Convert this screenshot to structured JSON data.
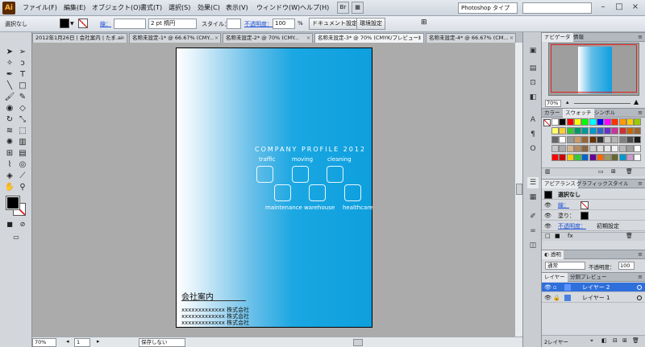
{
  "app": {
    "logo": "Ai"
  },
  "menu": [
    "ファイル(F)",
    "編集(E)",
    "オブジェクト(O)",
    "書式(T)",
    "選択(S)",
    "効果(C)",
    "表示(V)",
    "ウィンドウ(W)",
    "ヘルプ(H)"
  ],
  "workspace": "Photoshop タイプ",
  "window_controls": [
    "–",
    "□",
    "×"
  ],
  "control_bar": {
    "selection": "選択なし",
    "stroke_label": "線：",
    "stroke_weight": "2 pt 楕円",
    "style_label": "スタイル：",
    "opacity_label": "不透明度：",
    "opacity_value": "100",
    "opacity_unit": "%",
    "doc_setup": "ドキュメント設定",
    "env_setup": "環境設定"
  },
  "tabs": [
    {
      "label": "2012年1月26日 | 会社案内 | たま.ai",
      "active": false
    },
    {
      "label": "名称未設定-1* @ 66.67% (CMY...",
      "active": false
    },
    {
      "label": "名称未設定-2* @ 70% (CMY...",
      "active": false
    },
    {
      "label": "名称未設定-3* @ 70% (CMYK/プレビュー)",
      "active": true
    },
    {
      "label": "名称未設定-4* @ 66.67% (CM...",
      "active": false
    }
  ],
  "document": {
    "title": "COMPANY PROFILE 2012",
    "services_top": [
      "traffic",
      "moving",
      "cleaning"
    ],
    "services_bottom": [
      "maintenance",
      "warehouse",
      "healthcare"
    ],
    "heading": "会社案内",
    "lines": [
      "xxxxxxxxxxxxx 株式会社",
      "xxxxxxxxxxxxx 株式会社",
      "xxxxxxxxxxxxx 株式会社"
    ]
  },
  "status_bar": {
    "zoom": "70%",
    "page": "1",
    "status": "保存しない"
  },
  "navigator": {
    "tabs": [
      "ナビゲータ",
      "情報"
    ],
    "zoom": "70%"
  },
  "swatches": {
    "tabs": [
      "カラー",
      "スウォッチ",
      "シンボル"
    ],
    "rows": [
      [
        "#ffffff",
        "#000000",
        "#ff0000",
        "#ffff00",
        "#00ff00",
        "#00ffff",
        "#0000ff",
        "#ff00ff",
        "#ff3300",
        "#ff9900",
        "#ffcc00",
        "#99cc00"
      ],
      [
        "#ffff66",
        "#ffcc33",
        "#33cc33",
        "#009966",
        "#009999",
        "#0099cc",
        "#3366cc",
        "#6633cc",
        "#cc3399",
        "#cc3333",
        "#cc6600",
        "#996633"
      ],
      [
        "#666666",
        "#ffffff",
        "#999999",
        "#cc9966",
        "#996633",
        "#663300",
        "#333333",
        "#cccccc",
        "#b3b3b3",
        "#808080",
        "#4d4d4d",
        "#1a1a1a"
      ],
      [
        "#c8c8c8",
        "#aaaaaa",
        "#d9b38c",
        "#b38c66",
        "#8c6640",
        "#cfcfcf",
        "#dfdfdf",
        "#e8e8e8",
        "#f0f0f0",
        "#bbbbbb",
        "#a0a0a0",
        "#ffffff"
      ],
      [
        "#ff0000",
        "#cc0000",
        "#ffcc00",
        "#33cc33",
        "#0066cc",
        "#660099",
        "#ff6600",
        "#999966",
        "#666633",
        "#0099cc",
        "#cc99cc",
        "#ffffff"
      ]
    ]
  },
  "appearance": {
    "tabs": [
      "アピアランス",
      "グラフィックスタイル"
    ],
    "title": "選択なし",
    "stroke": "線：",
    "fill": "塗り：",
    "opacity": "不透明度：",
    "opacity_value": "初期設定"
  },
  "transparency": {
    "tab": "透明",
    "blend": "通常",
    "opacity_label": "不透明度：",
    "opacity_value": "100"
  },
  "layers": {
    "tabs": [
      "レイヤー",
      "分銅プレビュー"
    ],
    "items": [
      {
        "name": "レイヤー 2",
        "color": "#2f6fdb",
        "selected": true
      },
      {
        "name": "レイヤー 1",
        "color": "#4a7fe0",
        "selected": false
      }
    ],
    "count": "2レイヤー"
  },
  "icons": {
    "tools": [
      "selection-arrow",
      "direct-select",
      "magic-wand",
      "lasso",
      "pen",
      "type",
      "line",
      "rectangle",
      "paintbrush",
      "pencil",
      "blob-brush",
      "eraser",
      "rotate",
      "scale",
      "warp",
      "free-transform",
      "symbol-sprayer",
      "graph",
      "mesh",
      "gradient",
      "eyedropper",
      "blend",
      "live-paint",
      "slice",
      "hand",
      "zoom"
    ]
  }
}
